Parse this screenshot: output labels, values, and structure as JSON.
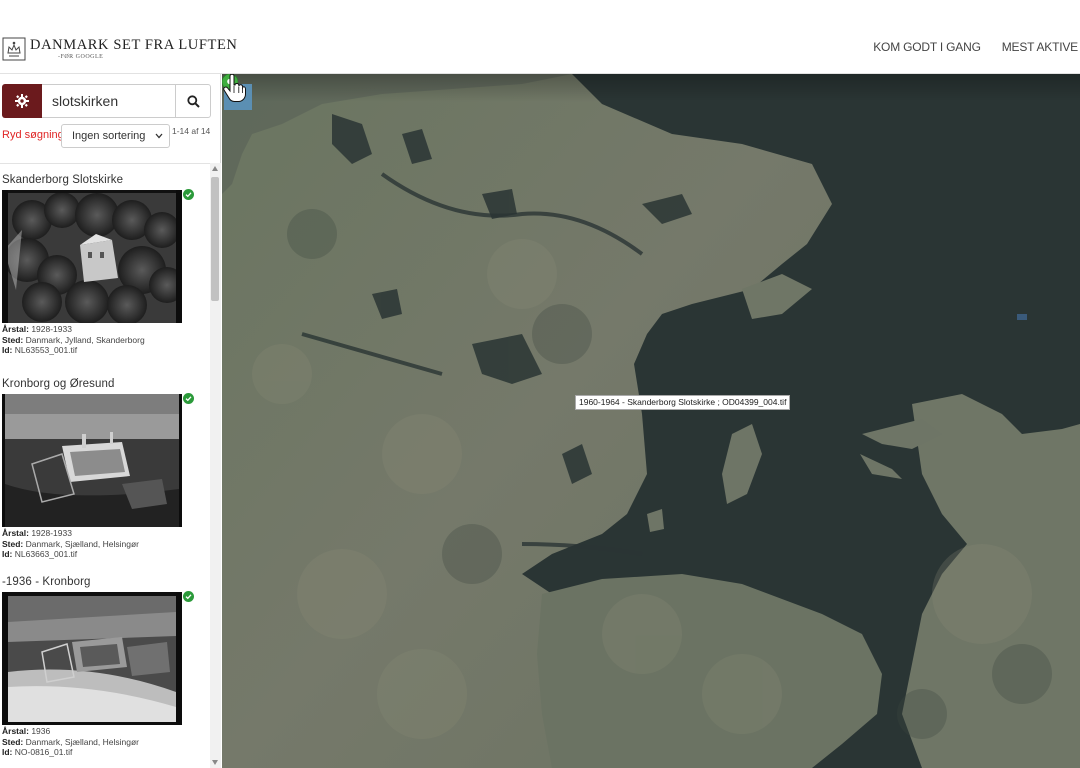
{
  "header": {
    "logo_title": "DANMARK SET FRA LUFTEN",
    "logo_sub": "-FØR GOOGLE",
    "nav": [
      "KOM GODT I GANG",
      "MEST AKTIVE"
    ]
  },
  "search": {
    "value": "slotskirken",
    "clear_label": "Ryd søgning",
    "sort_selected": "Ingen sortering",
    "count": "1-14 af 14"
  },
  "meta_labels": {
    "year": "Årstal:",
    "place": "Sted:",
    "id": "Id:"
  },
  "results": [
    {
      "title": "Skanderborg Slotskirke",
      "year": "1928-1933",
      "place": "Danmark, Jylland, Skanderborg",
      "id": "NL63553_001.tif"
    },
    {
      "title": "Kronborg og Øresund",
      "year": "1928-1933",
      "place": "Danmark, Sjælland, Helsingør",
      "id": "NL63663_001.tif"
    },
    {
      "title": "-1936 - Kronborg",
      "year": "1936",
      "place": "Danmark, Sjælland, Helsingør",
      "id": "NO-0816_01.tif"
    }
  ],
  "map": {
    "tooltip": "1960-1964 - Skanderborg Slotskirke ; OD04399_004.tif",
    "marker_color": "#3fae3f",
    "water_color": "#2a3534",
    "land_color": "#6e7866"
  },
  "icons": [
    "crest-icon",
    "gear-icon",
    "search-icon",
    "chevron-down-icon",
    "check-icon",
    "chevron-left-icon",
    "map-marker-icon",
    "hand-cursor-icon"
  ],
  "colors": {
    "brand": "#6b1a1d",
    "clear_link": "#e02424",
    "check": "#2b9a3a",
    "collapse": "#5b8fb3"
  }
}
